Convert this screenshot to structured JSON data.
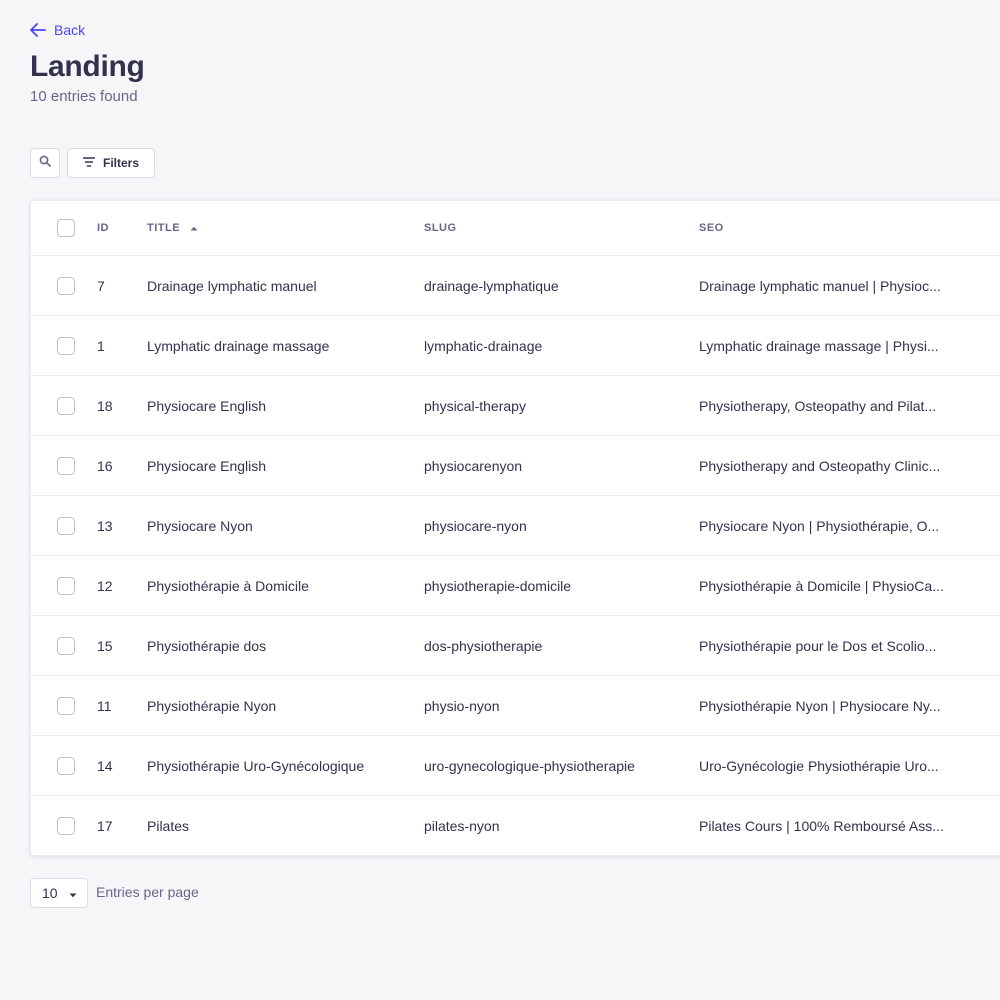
{
  "header": {
    "back_label": "Back",
    "title": "Landing",
    "subtitle": "10 entries found"
  },
  "toolbar": {
    "filters_label": "Filters"
  },
  "table": {
    "columns": {
      "id": "ID",
      "title": "TITLE",
      "slug": "SLUG",
      "seo": "SEO"
    },
    "sort": {
      "column": "title",
      "direction": "asc"
    },
    "rows": [
      {
        "id": "7",
        "title": "Drainage lymphatic manuel",
        "slug": "drainage-lymphatique",
        "seo": "Drainage lymphatic manuel | Physioc..."
      },
      {
        "id": "1",
        "title": "Lymphatic drainage massage",
        "slug": "lymphatic-drainage",
        "seo": "Lymphatic drainage massage | Physi..."
      },
      {
        "id": "18",
        "title": "Physiocare English",
        "slug": "physical-therapy",
        "seo": "Physiotherapy, Osteopathy and Pilat..."
      },
      {
        "id": "16",
        "title": "Physiocare English",
        "slug": "physiocarenyon",
        "seo": "Physiotherapy and Osteopathy Clinic..."
      },
      {
        "id": "13",
        "title": "Physiocare Nyon",
        "slug": "physiocare-nyon",
        "seo": "Physiocare Nyon | Physiothérapie, O..."
      },
      {
        "id": "12",
        "title": "Physiothérapie à Domicile",
        "slug": "physiotherapie-domicile",
        "seo": "Physiothérapie à Domicile | PhysioCa..."
      },
      {
        "id": "15",
        "title": "Physiothérapie dos",
        "slug": "dos-physiotherapie",
        "seo": "Physiothérapie pour le Dos et Scolio..."
      },
      {
        "id": "11",
        "title": "Physiothérapie Nyon",
        "slug": "physio-nyon",
        "seo": "Physiothérapie Nyon | Physiocare Ny..."
      },
      {
        "id": "14",
        "title": "Physiothérapie Uro-Gynécologique",
        "slug": "uro-gynecologique-physiotherapie",
        "seo": "Uro-Gynécologie Physiothérapie Uro..."
      },
      {
        "id": "17",
        "title": "Pilates",
        "slug": "pilates-nyon",
        "seo": "Pilates Cours | 100% Remboursé Ass..."
      }
    ]
  },
  "pagination": {
    "per_page_value": "10",
    "per_page_label": "Entries per page"
  },
  "colors": {
    "accent": "#4945ff",
    "background": "#f6f6f9",
    "text": "#32324d",
    "muted": "#666687"
  }
}
